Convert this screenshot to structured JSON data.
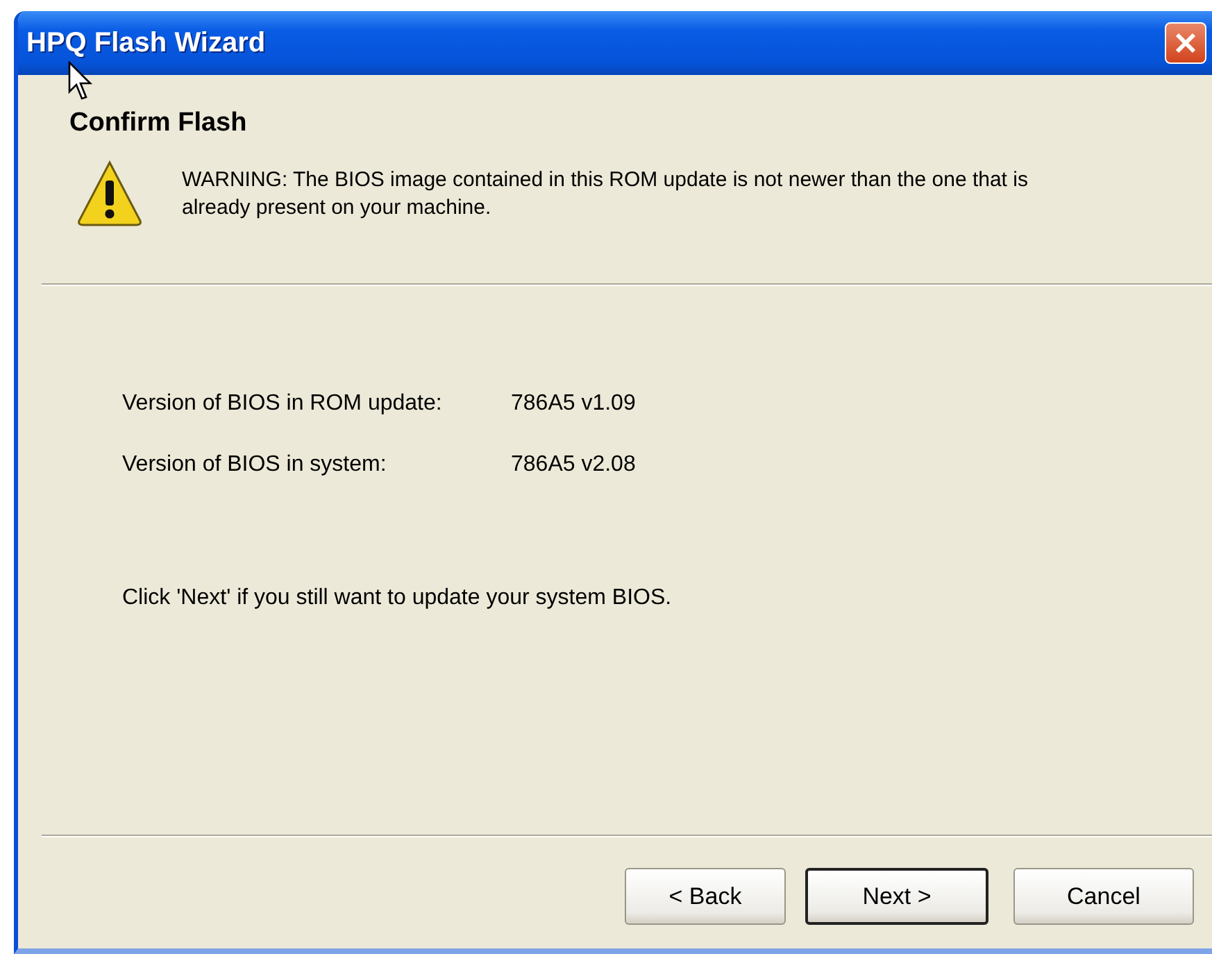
{
  "window": {
    "title": "HPQ Flash Wizard"
  },
  "header": {
    "title": "Confirm Flash",
    "warning": "WARNING: The BIOS image contained in this ROM update is not newer than the one that is already present on your machine."
  },
  "versions": [
    {
      "label": "Version of BIOS in ROM update:",
      "value": "786A5 v1.09"
    },
    {
      "label": "Version of BIOS in system:",
      "value": "786A5 v2.08"
    }
  ],
  "instruction": "Click 'Next' if you still want to update your system BIOS.",
  "buttons": [
    {
      "label": "< Back",
      "default": false
    },
    {
      "label": "Next >",
      "default": true
    },
    {
      "label": "Cancel",
      "default": false
    }
  ]
}
